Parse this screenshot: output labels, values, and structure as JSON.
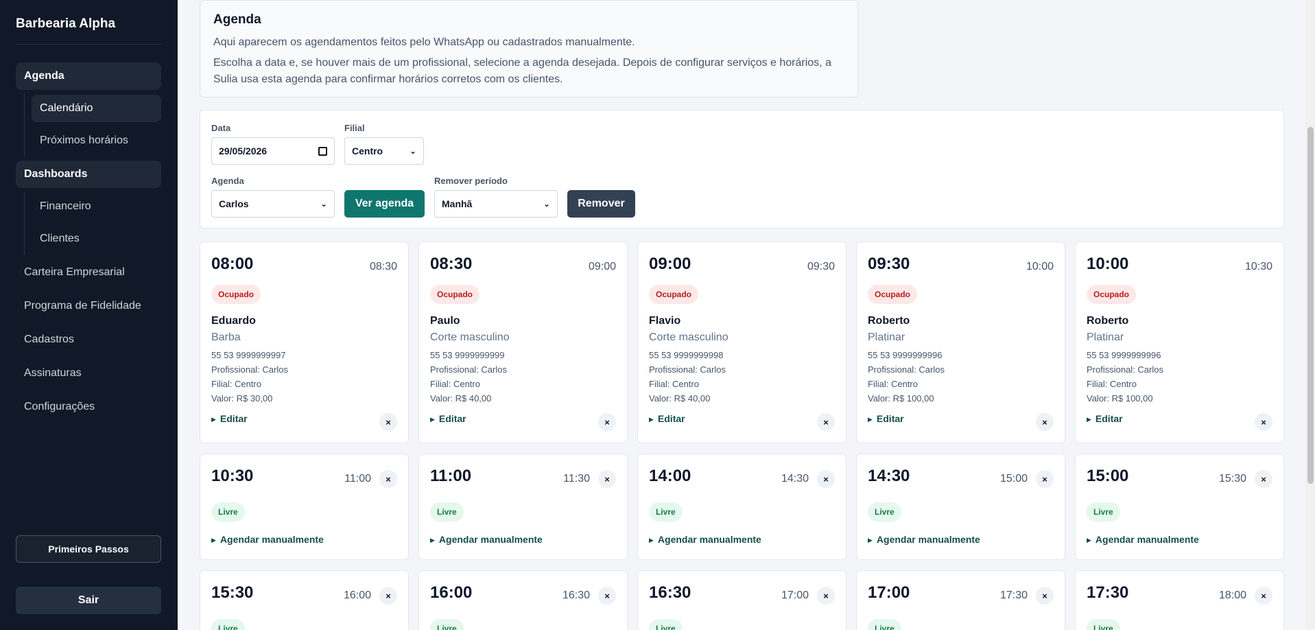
{
  "sidebar": {
    "brand": "Barbearia Alpha",
    "groups": [
      {
        "label": "Agenda",
        "items": [
          {
            "label": "Calendário",
            "active": true
          },
          {
            "label": "Próximos horários",
            "active": false
          }
        ]
      },
      {
        "label": "Dashboards",
        "items": [
          {
            "label": "Financeiro",
            "active": false
          },
          {
            "label": "Clientes",
            "active": false
          }
        ]
      }
    ],
    "links": [
      "Carteira Empresarial",
      "Programa de Fidelidade",
      "Cadastros",
      "Assinaturas",
      "Configurações"
    ],
    "first_steps": "Primeiros Passos",
    "logout": "Sair"
  },
  "info": {
    "title": "Agenda",
    "line1": "Aqui aparecem os agendamentos feitos pelo WhatsApp ou cadastrados manualmente.",
    "line2": "Escolha a data e, se houver mais de um profissional, selecione a agenda desejada. Depois de configurar serviços e horários, a Sulia usa esta agenda para confirmar horários corretos com os clientes."
  },
  "filters": {
    "date_label": "Data",
    "date_value": "29/05/2026",
    "branch_label": "Filial",
    "branch_value": "Centro",
    "agenda_label": "Agenda",
    "agenda_value": "Carlos",
    "view_button": "Ver agenda",
    "remove_period_label": "Remover período",
    "remove_period_value": "Manhã",
    "remove_button": "Remover"
  },
  "slots_booked": [
    {
      "start": "08:00",
      "end": "08:30",
      "status": "Ocupado",
      "client": "Eduardo",
      "service": "Barba",
      "phone": "55 53 9999999997",
      "professional": "Profissional: Carlos",
      "branch": "Filial: Centro",
      "value": "Valor: R$ 30,00",
      "action": "Editar"
    },
    {
      "start": "08:30",
      "end": "09:00",
      "status": "Ocupado",
      "client": "Paulo",
      "service": "Corte masculino",
      "phone": "55 53 9999999999",
      "professional": "Profissional: Carlos",
      "branch": "Filial: Centro",
      "value": "Valor: R$ 40,00",
      "action": "Editar"
    },
    {
      "start": "09:00",
      "end": "09:30",
      "status": "Ocupado",
      "client": "Flavio",
      "service": "Corte masculino",
      "phone": "55 53 9999999998",
      "professional": "Profissional: Carlos",
      "branch": "Filial: Centro",
      "value": "Valor: R$ 40,00",
      "action": "Editar"
    },
    {
      "start": "09:30",
      "end": "10:00",
      "status": "Ocupado",
      "client": "Roberto",
      "service": "Platinar",
      "phone": "55 53 9999999996",
      "professional": "Profissional: Carlos",
      "branch": "Filial: Centro",
      "value": "Valor: R$ 100,00",
      "action": "Editar"
    },
    {
      "start": "10:00",
      "end": "10:30",
      "status": "Ocupado",
      "client": "Roberto",
      "service": "Platinar",
      "phone": "55 53 9999999996",
      "professional": "Profissional: Carlos",
      "branch": "Filial: Centro",
      "value": "Valor: R$ 100,00",
      "action": "Editar"
    }
  ],
  "slots_free": [
    {
      "start": "10:30",
      "end": "11:00",
      "status": "Livre",
      "action": "Agendar manualmente"
    },
    {
      "start": "11:00",
      "end": "11:30",
      "status": "Livre",
      "action": "Agendar manualmente"
    },
    {
      "start": "14:00",
      "end": "14:30",
      "status": "Livre",
      "action": "Agendar manualmente"
    },
    {
      "start": "14:30",
      "end": "15:00",
      "status": "Livre",
      "action": "Agendar manualmente"
    },
    {
      "start": "15:00",
      "end": "15:30",
      "status": "Livre",
      "action": "Agendar manualmente"
    }
  ],
  "slots_free_2": [
    {
      "start": "15:30",
      "end": "16:00",
      "status": "Livre"
    },
    {
      "start": "16:00",
      "end": "16:30",
      "status": "Livre"
    },
    {
      "start": "16:30",
      "end": "17:00",
      "status": "Livre"
    },
    {
      "start": "17:00",
      "end": "17:30",
      "status": "Livre"
    },
    {
      "start": "17:30",
      "end": "18:00",
      "status": "Livre"
    }
  ],
  "colors": {
    "sidebar": "#111827",
    "primary": "#0f766e",
    "danger_bg": "#fde8e8",
    "danger_text": "#b91c1c",
    "success_bg": "#e5f7ee",
    "success_text": "#15803d"
  }
}
